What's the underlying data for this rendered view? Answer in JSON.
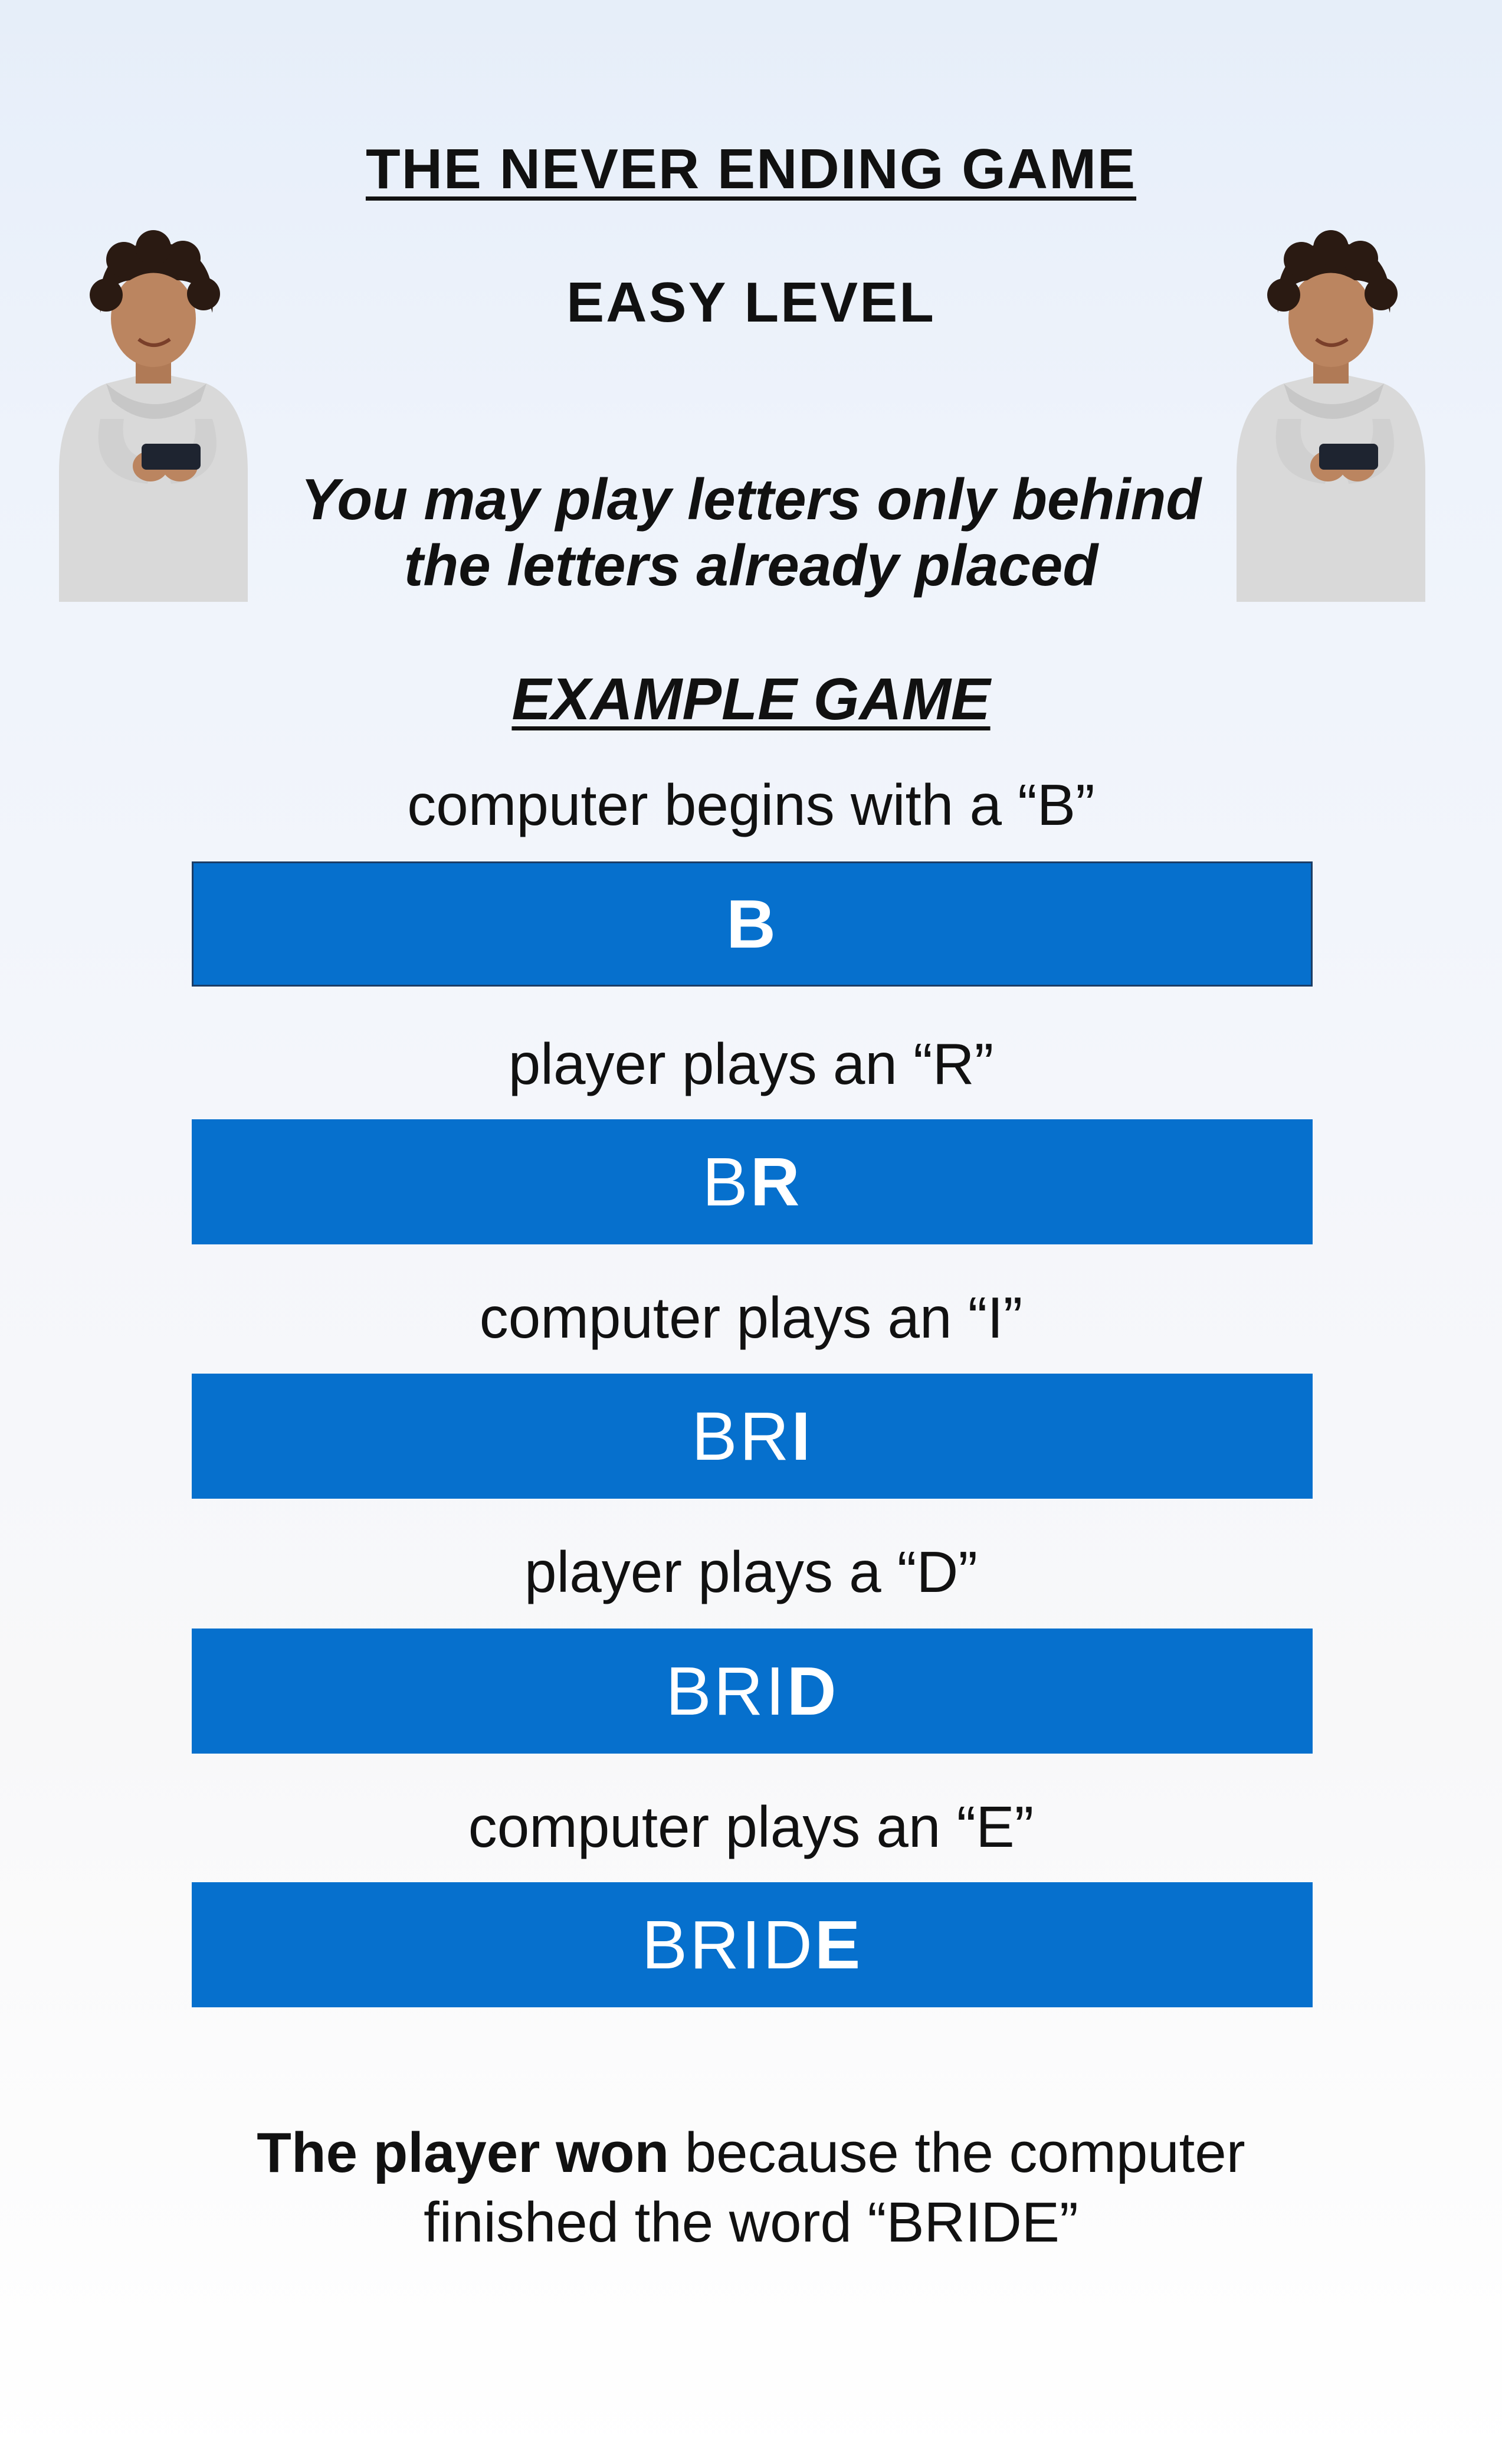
{
  "header": {
    "title": "THE NEVER ENDING GAME",
    "level": "EASY LEVEL",
    "rule_line1": "You may play letters only behind",
    "rule_line2": "the letters already placed"
  },
  "example": {
    "title": "EXAMPLE GAME",
    "steps": [
      {
        "caption": "computer begins with a “B”",
        "prev": "",
        "new": "B"
      },
      {
        "caption": "player plays an “R”",
        "prev": "B",
        "new": "R"
      },
      {
        "caption": "computer plays an “I”",
        "prev": "BR",
        "new": "I"
      },
      {
        "caption": "player plays a “D”",
        "prev": "BRI",
        "new": "D"
      },
      {
        "caption": "computer plays an “E”",
        "prev": "BRID",
        "new": "E"
      }
    ]
  },
  "result": {
    "bold": "The player won",
    "rest_line1": " because the computer",
    "line2": "finished the word “BRIDE”"
  },
  "colors": {
    "bar": "#0670cd",
    "bar_text": "#ffffff"
  },
  "icons": {
    "left_image": "person-with-phone-icon",
    "right_image": "person-with-phone-icon"
  }
}
